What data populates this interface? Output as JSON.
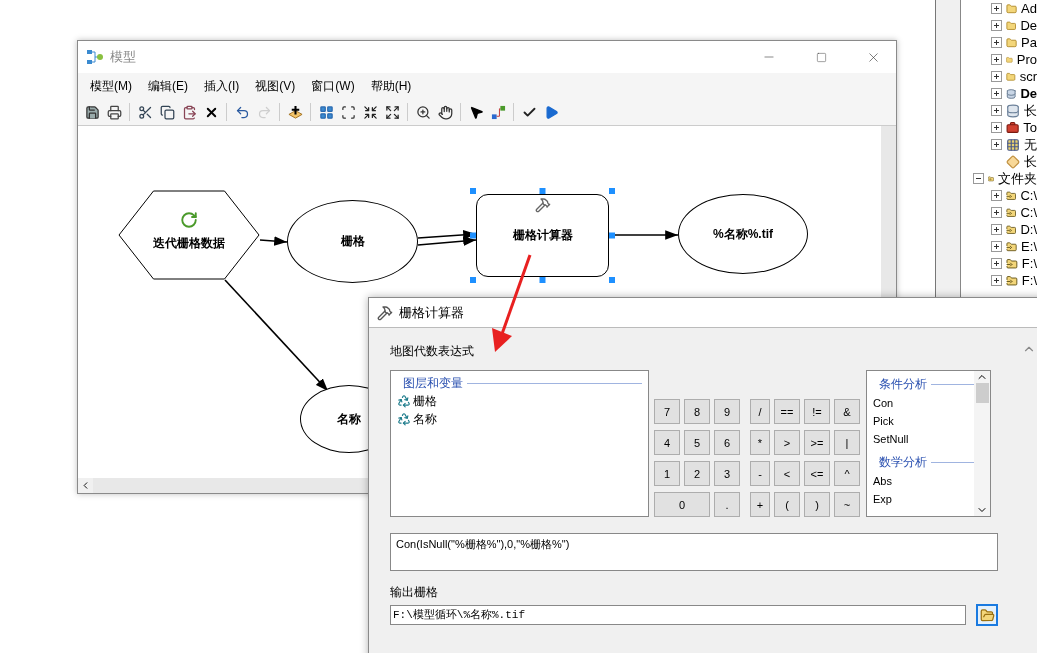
{
  "catalog_tree": {
    "continued_items": [
      {
        "label": "Ad",
        "kind": "folder",
        "expanded": false
      },
      {
        "label": "De",
        "kind": "folder",
        "expanded": false
      },
      {
        "label": "Pa",
        "kind": "folder",
        "expanded": false
      },
      {
        "label": "Pro",
        "kind": "folder",
        "expanded": false
      },
      {
        "label": "scr",
        "kind": "folder",
        "expanded": false
      },
      {
        "label": "De",
        "kind": "home-database",
        "expanded": false,
        "bold": true
      },
      {
        "label": "长",
        "kind": "database",
        "expanded": false
      },
      {
        "label": "To",
        "kind": "toolbox",
        "expanded": false
      },
      {
        "label": "无",
        "kind": "raster",
        "expanded": false
      },
      {
        "label": "长",
        "kind": "diamond"
      }
    ],
    "nodes": [
      {
        "label": "文件夹",
        "kind": "folder-connection",
        "expanded": true,
        "children": [
          {
            "label": "C:\\",
            "kind": "folder-connection",
            "expanded": false
          },
          {
            "label": "C:\\",
            "kind": "folder-connection",
            "expanded": false
          },
          {
            "label": "D:\\",
            "kind": "folder-connection",
            "expanded": false
          },
          {
            "label": "E:\\",
            "kind": "folder-connection",
            "expanded": false
          },
          {
            "label": "F:\\",
            "kind": "folder-connection",
            "expanded": false
          },
          {
            "label": "F:\\",
            "kind": "folder-connection",
            "expanded": false
          }
        ]
      }
    ]
  },
  "model_window": {
    "title": "模型",
    "menu": [
      "模型(M)",
      "编辑(E)",
      "插入(I)",
      "视图(V)",
      "窗口(W)",
      "帮助(H)"
    ],
    "toolbar": [
      {
        "kind": "save",
        "disabled": false
      },
      {
        "kind": "print",
        "disabled": false
      },
      {
        "kind": "separator"
      },
      {
        "kind": "cut",
        "disabled": false
      },
      {
        "kind": "copy",
        "disabled": false
      },
      {
        "kind": "paste",
        "disabled": false
      },
      {
        "kind": "delete",
        "disabled": false
      },
      {
        "kind": "separator"
      },
      {
        "kind": "undo",
        "disabled": false
      },
      {
        "kind": "redo",
        "disabled": true
      },
      {
        "kind": "separator"
      },
      {
        "kind": "add-data",
        "disabled": false
      },
      {
        "kind": "separator"
      },
      {
        "kind": "auto-layout",
        "disabled": false
      },
      {
        "kind": "full-extent",
        "disabled": false
      },
      {
        "kind": "shrink",
        "disabled": false
      },
      {
        "kind": "expand",
        "disabled": false
      },
      {
        "kind": "separator"
      },
      {
        "kind": "zoom-in",
        "disabled": false
      },
      {
        "kind": "pan",
        "disabled": false
      },
      {
        "kind": "separator"
      },
      {
        "kind": "select",
        "disabled": false
      },
      {
        "kind": "connect",
        "disabled": false
      },
      {
        "kind": "separator"
      },
      {
        "kind": "validate",
        "disabled": false
      },
      {
        "kind": "run",
        "disabled": false
      }
    ],
    "nodes": [
      {
        "label": "迭代栅格数据",
        "kind": "iterator",
        "selected": false
      },
      {
        "label": "栅格",
        "kind": "variable",
        "selected": false
      },
      {
        "label": "栅格计算器",
        "kind": "tool",
        "selected": true
      },
      {
        "label": "%名称%.tif",
        "kind": "variable",
        "selected": false
      },
      {
        "label": "名称",
        "kind": "variable",
        "selected": false
      }
    ]
  },
  "raster_calculator": {
    "title": "栅格计算器",
    "expression_label": "地图代数表达式",
    "layers": {
      "heading": "图层和变量",
      "items": [
        "栅格",
        "名称"
      ]
    },
    "keypad": [
      [
        "7",
        "8",
        "9",
        "/",
        "==",
        "!=",
        "&"
      ],
      [
        "4",
        "5",
        "6",
        "*",
        ">",
        ">=",
        "|"
      ],
      [
        "1",
        "2",
        "3",
        "-",
        "<",
        "<=",
        "^"
      ],
      [
        "0",
        ".",
        "+",
        "(",
        ")",
        "~"
      ]
    ],
    "functions": [
      {
        "heading": "条件分析",
        "items": [
          "Con",
          "Pick",
          "SetNull"
        ]
      },
      {
        "heading": "数学分析",
        "items": [
          "Abs",
          "Exp"
        ]
      }
    ],
    "expression": "Con(IsNull(\"%栅格%\"),0,\"%栅格%\")",
    "output_label": "输出栅格",
    "output_value": "F:\\模型循环\\%名称%.tif"
  }
}
